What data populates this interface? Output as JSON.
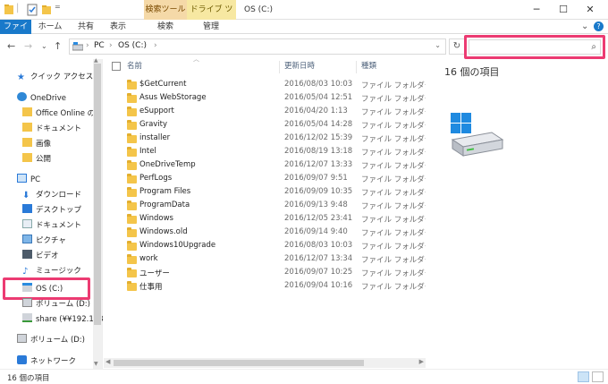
{
  "titlebar": {
    "ctx_search_tab": "検索ツール",
    "ctx_drive_tab": "ドライブ ツール",
    "window_title": "OS (C:)",
    "minimize": "─",
    "maximize": "☐",
    "close": "✕"
  },
  "ribbon": {
    "tabs": [
      "ファイル",
      "ホーム",
      "共有",
      "表示",
      "検索",
      "管理"
    ],
    "expand": "⌄",
    "help": "?"
  },
  "address": {
    "back": "←",
    "forward": "→",
    "recent": "⌄",
    "up": "↑",
    "crumbs": [
      "PC",
      "OS (C:)"
    ],
    "sep": "›",
    "refresh": "↻",
    "search_placeholder": ""
  },
  "nav": {
    "items": [
      {
        "label": "クイック アクセス",
        "icon": "star-icon"
      },
      {
        "label": "OneDrive",
        "icon": "cloud-icon"
      },
      {
        "label": "Office Online の",
        "icon": "folder-icon"
      },
      {
        "label": "ドキュメント",
        "icon": "folder-icon"
      },
      {
        "label": "画像",
        "icon": "folder-icon"
      },
      {
        "label": "公開",
        "icon": "folder-icon"
      },
      {
        "label": "PC",
        "icon": "pc-icon"
      },
      {
        "label": "ダウンロード",
        "icon": "download-icon"
      },
      {
        "label": "デスクトップ",
        "icon": "desktop-icon"
      },
      {
        "label": "ドキュメント",
        "icon": "documents-icon"
      },
      {
        "label": "ピクチャ",
        "icon": "pictures-icon"
      },
      {
        "label": "ビデオ",
        "icon": "video-icon"
      },
      {
        "label": "ミュージック",
        "icon": "music-icon"
      },
      {
        "label": "OS (C:)",
        "icon": "drive-icon"
      },
      {
        "label": "ボリューム (D:)",
        "icon": "drive-icon"
      },
      {
        "label": "share (¥¥192.168",
        "icon": "network-drive-icon"
      },
      {
        "label": "ボリューム (D:)",
        "icon": "drive-icon"
      },
      {
        "label": "ネットワーク",
        "icon": "network-icon"
      }
    ]
  },
  "filelist": {
    "columns": {
      "name": "名前",
      "date": "更新日時",
      "type": "種類"
    },
    "rows": [
      {
        "name": "$GetCurrent",
        "date": "2016/08/03 10:03",
        "type": "ファイル フォルダー"
      },
      {
        "name": "Asus WebStorage",
        "date": "2016/05/04 12:51",
        "type": "ファイル フォルダー"
      },
      {
        "name": "eSupport",
        "date": "2016/04/20 1:13",
        "type": "ファイル フォルダー"
      },
      {
        "name": "Gravity",
        "date": "2016/05/04 14:28",
        "type": "ファイル フォルダー"
      },
      {
        "name": "installer",
        "date": "2016/12/02 15:39",
        "type": "ファイル フォルダー"
      },
      {
        "name": "Intel",
        "date": "2016/08/19 13:18",
        "type": "ファイル フォルダー"
      },
      {
        "name": "OneDriveTemp",
        "date": "2016/12/07 13:33",
        "type": "ファイル フォルダー"
      },
      {
        "name": "PerfLogs",
        "date": "2016/09/07 9:51",
        "type": "ファイル フォルダー"
      },
      {
        "name": "Program Files",
        "date": "2016/09/09 10:35",
        "type": "ファイル フォルダー"
      },
      {
        "name": "ProgramData",
        "date": "2016/09/13 9:48",
        "type": "ファイル フォルダー"
      },
      {
        "name": "Windows",
        "date": "2016/12/05 23:41",
        "type": "ファイル フォルダー"
      },
      {
        "name": "Windows.old",
        "date": "2016/09/14 9:40",
        "type": "ファイル フォルダー"
      },
      {
        "name": "Windows10Upgrade",
        "date": "2016/08/03 10:03",
        "type": "ファイル フォルダー"
      },
      {
        "name": "work",
        "date": "2016/12/07 13:34",
        "type": "ファイル フォルダー"
      },
      {
        "name": "ユーザー",
        "date": "2016/09/07 10:25",
        "type": "ファイル フォルダー"
      },
      {
        "name": "仕事用",
        "date": "2016/09/04 10:16",
        "type": "ファイル フォルダー"
      }
    ]
  },
  "details": {
    "count": "16 個の項目"
  },
  "status": {
    "count": "16 個の項目"
  },
  "colors": {
    "accent": "#1979ca",
    "highlight": "#ec3b72",
    "folder": "#f4c54a"
  }
}
